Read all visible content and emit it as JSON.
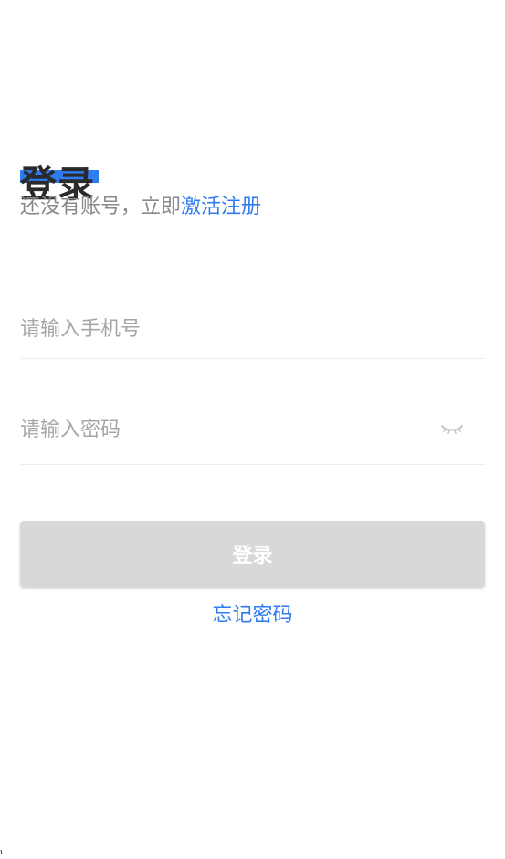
{
  "login": {
    "title": "登录",
    "subtitle_prefix": "还没有账号，立即",
    "register_link": "激活注册",
    "phone_placeholder": "请输入手机号",
    "password_placeholder": "请输入密码",
    "password_visibility_icon": "eye-closed-icon",
    "submit_label": "登录",
    "forgot_password": "忘记密码",
    "colors": {
      "accent": "#2f7bf0",
      "title": "#2a2a2a",
      "muted_text": "#8a8a8a",
      "placeholder": "#a6a6a6",
      "button_disabled": "#d8d8d8",
      "divider": "#ededed"
    }
  }
}
